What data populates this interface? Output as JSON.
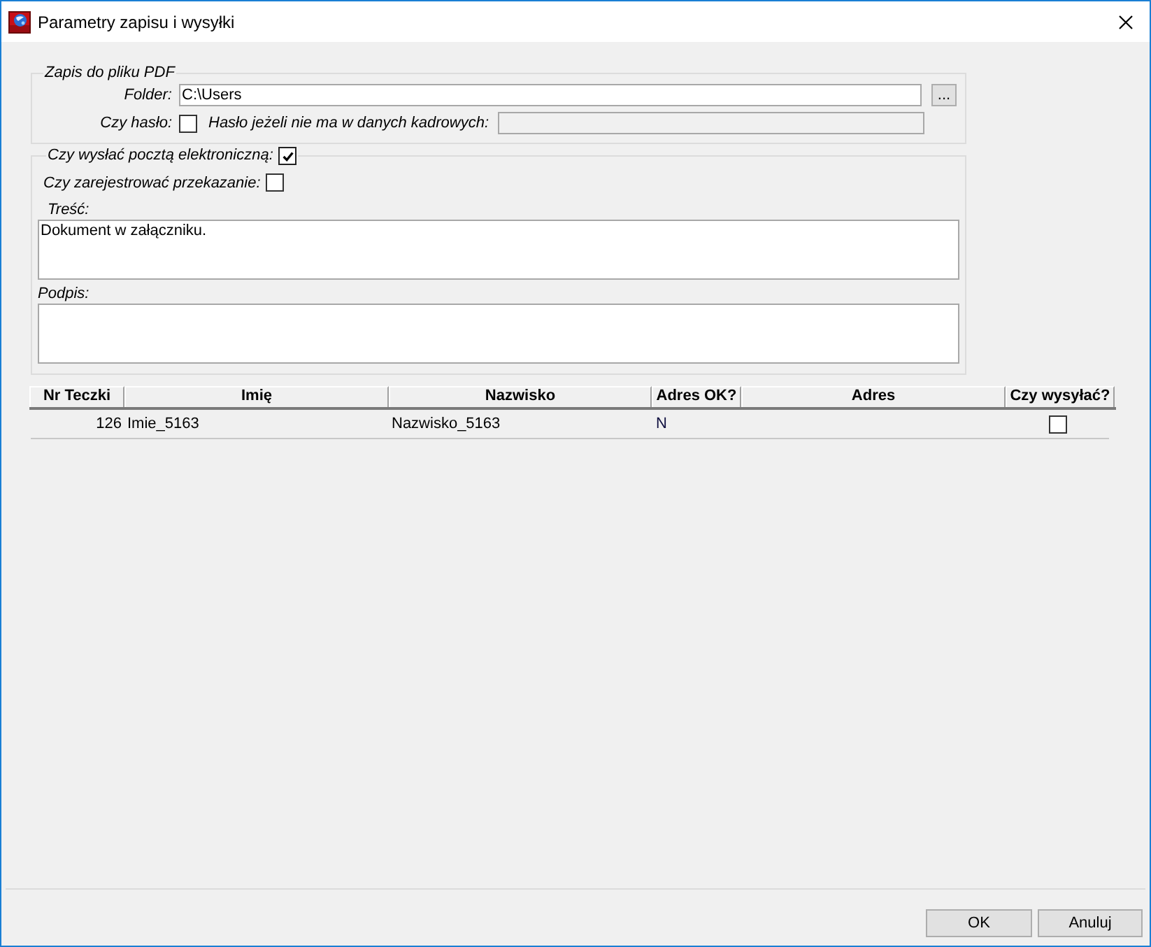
{
  "window": {
    "title": "Parametry zapisu i wysyłki"
  },
  "pdf_group": {
    "legend": "Zapis do pliku PDF",
    "folder": {
      "label": "Folder:",
      "value": "C:\\Users"
    },
    "browse_button": "...",
    "password": {
      "label": "Czy hasło:",
      "checked": false
    },
    "password_field": {
      "label": "Hasło jeżeli nie ma w danych kadrowych:",
      "disabled": true
    }
  },
  "email_group": {
    "send_email": {
      "label": "Czy wysłać pocztą elektroniczną:",
      "checked": true
    },
    "register": {
      "label": "Czy zarejestrować przekazanie:",
      "checked": false
    },
    "body": {
      "label": "Treść:",
      "value": "Dokument w załączniku."
    },
    "signature": {
      "label": "Podpis:"
    }
  },
  "table": {
    "columns": [
      "Nr Teczki",
      "Imię",
      "Nazwisko",
      "Adres OK?",
      "Adres",
      "Czy wysyłać?"
    ],
    "rows": [
      {
        "nr_teczki": "126",
        "imie": "Imie_5163",
        "nazwisko": "Nazwisko_5163",
        "adres_ok": "N",
        "send": false
      }
    ]
  },
  "buttons": [
    "OK",
    "Anuluj"
  ]
}
